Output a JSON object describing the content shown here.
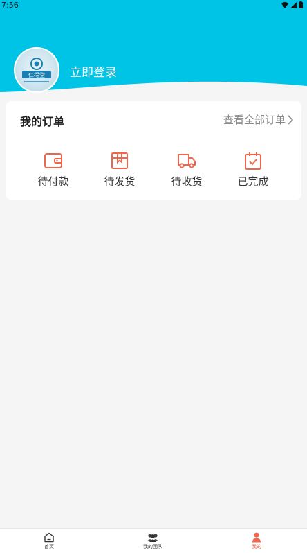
{
  "status_bar": {
    "time": "7:56",
    "icons": [
      "wifi-icon",
      "signal-icon",
      "battery-icon"
    ]
  },
  "profile": {
    "avatar_logo_text": "仁得堂",
    "login_label": "立即登录"
  },
  "orders": {
    "title": "我的订单",
    "view_all_label": "查看全部订单",
    "items": [
      {
        "label": "待付款",
        "icon": "wallet-icon"
      },
      {
        "label": "待发货",
        "icon": "package-icon"
      },
      {
        "label": "待收货",
        "icon": "delivery-truck-icon"
      },
      {
        "label": "已完成",
        "icon": "calendar-check-icon"
      }
    ]
  },
  "tabbar": {
    "tabs": [
      {
        "label": "首页",
        "icon": "home-icon",
        "active": false
      },
      {
        "label": "我的团队",
        "icon": "team-icon",
        "active": false
      },
      {
        "label": "我的",
        "icon": "user-icon",
        "active": true
      }
    ]
  },
  "colors": {
    "header": "#00c4e6",
    "accent": "#f0664c",
    "background": "#f5f5f5"
  }
}
